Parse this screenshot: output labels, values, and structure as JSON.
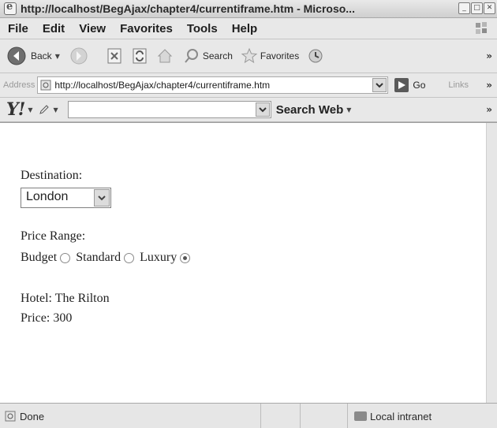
{
  "window": {
    "title": "http://localhost/BegAjax/chapter4/currentiframe.htm - Microso...",
    "buttons": [
      "_",
      "□",
      "✕"
    ]
  },
  "menu": [
    "File",
    "Edit",
    "View",
    "Favorites",
    "Tools",
    "Help"
  ],
  "toolbar": {
    "back_label": "Back",
    "search_label": "Search",
    "favorites_label": "Favorites",
    "more": "»"
  },
  "address": {
    "label": "Address",
    "url": "http://localhost/BegAjax/chapter4/currentiframe.htm",
    "go_label": "Go",
    "links_label": "Links",
    "more": "»"
  },
  "yahoo": {
    "logo": "Y!",
    "search_value": "",
    "search_web_label": "Search Web",
    "more": "»"
  },
  "content": {
    "destination_label": "Destination:",
    "destination_value": "London",
    "price_range_label": "Price Range:",
    "options": [
      {
        "label": "Budget",
        "checked": false
      },
      {
        "label": "Standard",
        "checked": false
      },
      {
        "label": "Luxury",
        "checked": true
      }
    ],
    "hotel_line": "Hotel: The Rilton",
    "price_line": "Price: 300"
  },
  "status": {
    "text": "Done",
    "zone": "Local intranet"
  }
}
